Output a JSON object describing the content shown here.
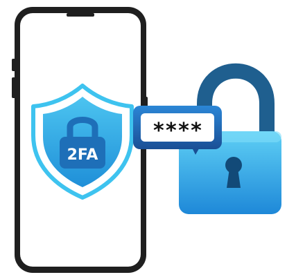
{
  "shield": {
    "badge_text": "2FA"
  },
  "password_field": {
    "masked_value": "****"
  },
  "colors": {
    "phone_frame": "#1f1f1f",
    "phone_screen": "#ffffff",
    "shield_outline": "#3ec3ef",
    "shield_fill": "#29a9e6",
    "shield_lock_body": "#1e6fb8",
    "lock_shackle": "#1f5f8f",
    "lock_body_top": "#5fd0f5",
    "lock_body_bottom": "#1e88d8",
    "keyhole": "#124a78",
    "field_border": "#1e5fa8",
    "field_fill": "#ffffff",
    "field_text": "#111111"
  },
  "icons": [
    "smartphone-icon",
    "shield-2fa-icon",
    "padlock-icon",
    "keyhole-icon",
    "password-field-icon"
  ]
}
